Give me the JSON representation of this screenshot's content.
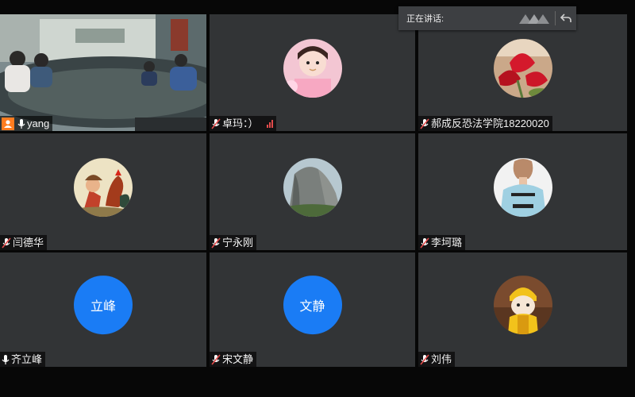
{
  "speaking_banner": {
    "label": "正在讲话:",
    "icons": [
      "logo-mark-icon",
      "return-icon"
    ]
  },
  "participants": [
    {
      "name": "yang",
      "host": true,
      "mic": "on",
      "video": true
    },
    {
      "name": "卓玛：）",
      "mic": "muted",
      "signal": true,
      "avatar": "girl-photo"
    },
    {
      "name": "郝成反恐法学院18220020",
      "mic": "muted",
      "avatar": "red-flower-photo"
    },
    {
      "name": "闫德华",
      "mic": "muted",
      "avatar": "painting-rooster"
    },
    {
      "name": "宁永刚",
      "mic": "muted",
      "avatar": "mountain-cliff-photo"
    },
    {
      "name": "李坷璐",
      "mic": "muted",
      "avatar": "dont-care-shirt-photo"
    },
    {
      "name": "齐立峰",
      "mic": "on",
      "initials": "立峰",
      "avatar_color": "#1a7cf5"
    },
    {
      "name": "宋文静",
      "mic": "muted",
      "initials": "文静",
      "avatar_color": "#1a7cf5"
    },
    {
      "name": "刘伟",
      "mic": "muted",
      "avatar": "cartoon-doll"
    }
  ],
  "colors": {
    "background": "#070707",
    "tile": "#323436",
    "host_badge": "#ff7c1f",
    "initial_avatar": "#1a7cf5",
    "muted_mic": "#e34b4b"
  }
}
